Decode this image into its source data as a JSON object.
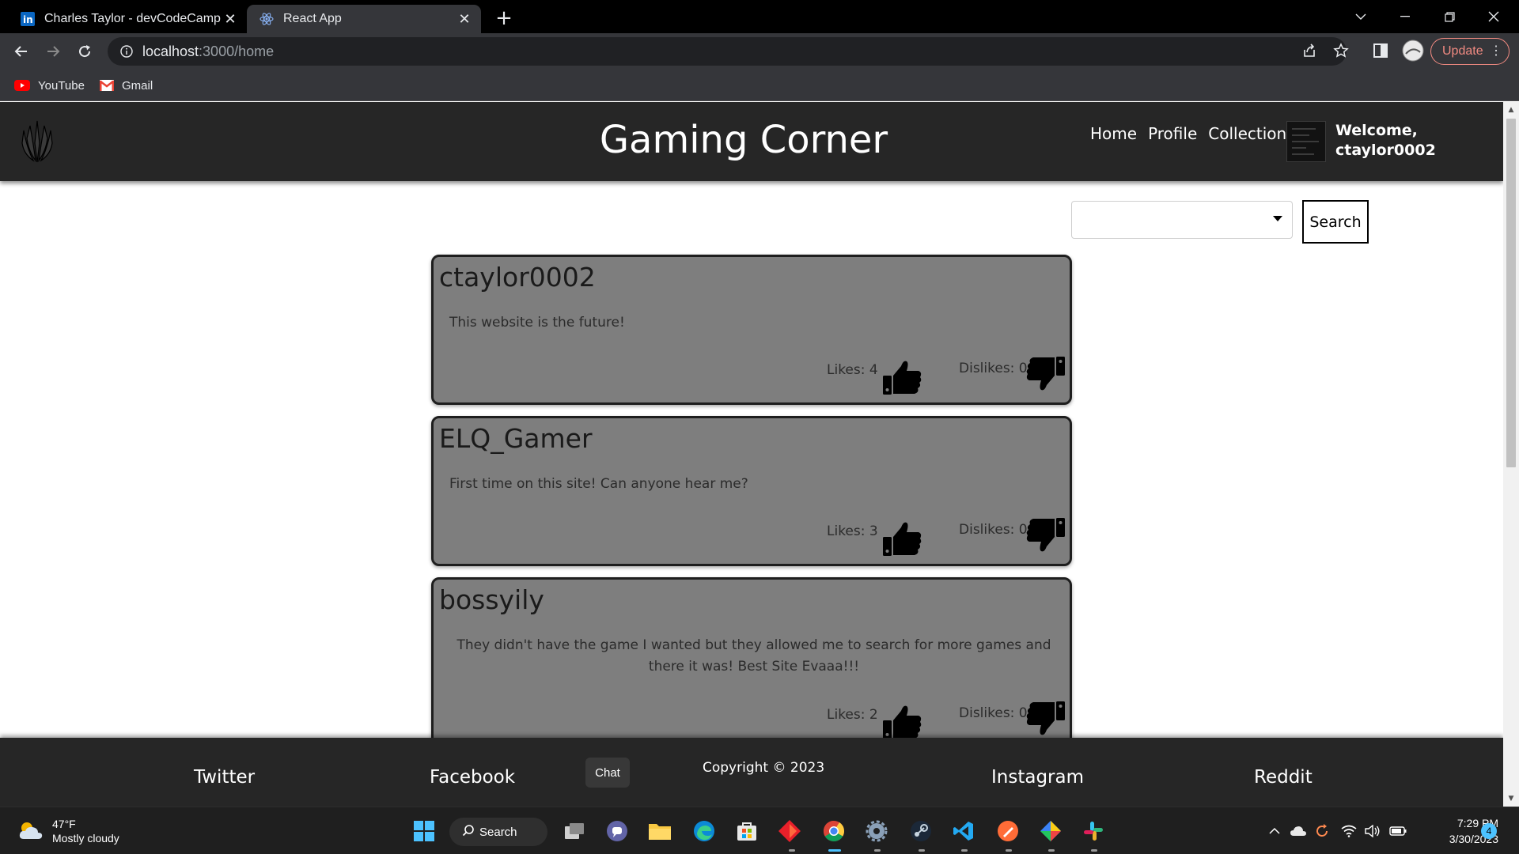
{
  "browser": {
    "tabs": [
      {
        "title": "Charles Taylor - devCodeCamp -",
        "favicon": "linkedin-icon"
      },
      {
        "title": "React App",
        "favicon": "react-icon",
        "active": true
      }
    ],
    "url_host": "localhost",
    "url_path": ":3000/home",
    "update_label": "Update",
    "bookmarks": [
      {
        "label": "YouTube",
        "icon": "youtube-icon"
      },
      {
        "label": "Gmail",
        "icon": "gmail-icon"
      }
    ]
  },
  "header": {
    "title": "Gaming Corner",
    "nav": [
      "Home",
      "Profile",
      "Collection"
    ],
    "welcome_line1": "Welcome,",
    "welcome_line2": "ctaylor0002"
  },
  "search": {
    "value": "",
    "button_label": "Search"
  },
  "posts": [
    {
      "author": "ctaylor0002",
      "body": "This website is the future!",
      "likes": "Likes: 4",
      "dislikes": "Dislikes: 0"
    },
    {
      "author": "ELQ_Gamer",
      "body": "First time on this site! Can anyone hear me?",
      "likes": "Likes: 3",
      "dislikes": "Dislikes: 0"
    },
    {
      "author": "bossyily",
      "body": "They didn't have the game I wanted but they allowed me to search for more games and there it was! Best Site Evaaa!!!",
      "likes": "Likes: 2",
      "dislikes": "Dislikes: 0"
    }
  ],
  "footer": {
    "links": [
      "Twitter",
      "Facebook",
      "Instagram",
      "Reddit"
    ],
    "copyright": "Copyright © 2023",
    "tooltip": "Chat"
  },
  "taskbar": {
    "temperature": "47°F",
    "weather": "Mostly cloudy",
    "search_label": "Search",
    "time": "7:29 PM",
    "date": "3/30/2023",
    "notifications": "4"
  },
  "colors": {
    "header_bg": "#262626",
    "card_bg": "#7e7e7e",
    "browser_bg": "#35363a",
    "accent": "#4cc2ff"
  }
}
